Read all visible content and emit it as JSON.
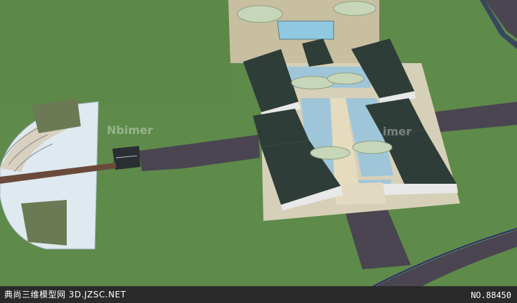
{
  "watermark": {
    "text": "Nbimer",
    "partial_text": "imer"
  },
  "footer": {
    "left_text": "典尚三维模型网 3D.JZSC.NET",
    "right_text": "NO.88450"
  },
  "colors": {
    "lawn": "#5e8a4a",
    "road": "#4a4550",
    "water": "#9fc6d8",
    "roof": "#2f3d38",
    "plaza": "#c8bfa0"
  }
}
